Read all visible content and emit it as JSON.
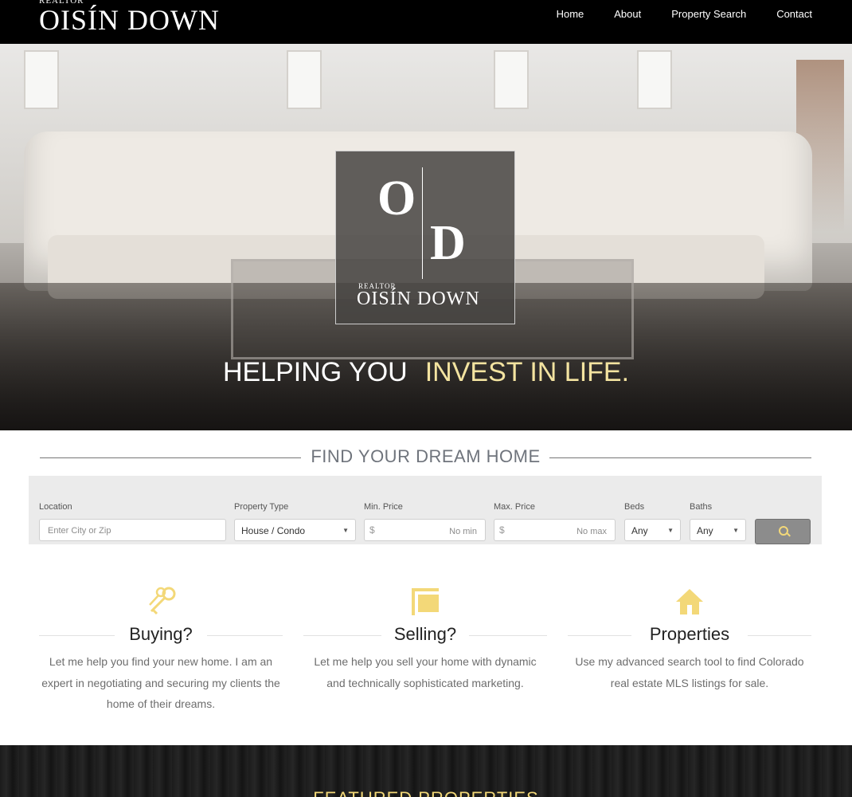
{
  "brand": {
    "sub": "REALTOR",
    "name": "OISÍN DOWN",
    "monogram_o": "O",
    "monogram_d": "D"
  },
  "nav": {
    "items": [
      "Home",
      "About",
      "Property Search",
      "Contact"
    ]
  },
  "hero": {
    "tagline_white": "HELPING YOU",
    "tagline_gold": "INVEST IN LIFE."
  },
  "search": {
    "title": "FIND YOUR DREAM HOME",
    "location_label": "Location",
    "location_placeholder": "Enter City or Zip",
    "type_label": "Property Type",
    "type_value": "House / Condo",
    "min_label": "Min. Price",
    "min_currency": "$",
    "min_placeholder": "No min",
    "max_label": "Max. Price",
    "max_currency": "$",
    "max_placeholder": "No max",
    "beds_label": "Beds",
    "beds_value": "Any",
    "baths_label": "Baths",
    "baths_value": "Any"
  },
  "features": [
    {
      "title": "Buying?",
      "desc": "Let me help you find your new home. I am an expert in negotiating and securing my clients the home of their dreams.",
      "icon": "keys-icon"
    },
    {
      "title": "Selling?",
      "desc": "Let me help you sell your home with dynamic and technically sophisticated marketing.",
      "icon": "sign-icon"
    },
    {
      "title": "Properties",
      "desc": "Use my advanced search tool to find Colorado real estate MLS listings for sale.",
      "icon": "house-icon"
    }
  ],
  "featured": {
    "title": "FEATURED PROPERTIES"
  },
  "colors": {
    "accent_gold": "#f3d878",
    "nav_bg": "#000000"
  }
}
